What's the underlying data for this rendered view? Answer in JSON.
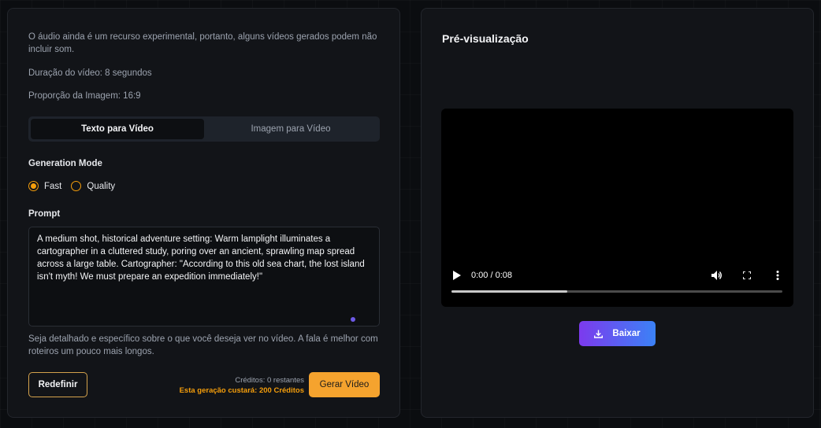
{
  "generator": {
    "notes": {
      "audio": "O áudio ainda é um recurso experimental, portanto, alguns vídeos gerados podem não incluir som.",
      "duration": "Duração do vídeo: 8 segundos",
      "aspect": "Proporção da Imagem: 16:9"
    },
    "tabs": [
      {
        "label": "Texto para Vídeo",
        "active": true
      },
      {
        "label": "Imagem para Vídeo",
        "active": false
      }
    ],
    "generation_mode": {
      "label": "Generation Mode",
      "options": [
        "Fast",
        "Quality"
      ],
      "selected": "Fast"
    },
    "prompt": {
      "label": "Prompt",
      "value": "A medium shot, historical adventure setting: Warm lamplight illuminates a cartographer in a cluttered study, poring over an ancient, sprawling map spread across a large table. Cartographer: \"According to this old sea chart, the lost island isn't myth! We must prepare an expedition immediately!\""
    },
    "hint": "Seja detalhado e específico sobre o que você deseja ver no vídeo. A fala é melhor com roteiros um pouco mais longos.",
    "reset_label": "Redefinir",
    "credits_remaining": "Créditos: 0 restantes",
    "cost_note": "Esta geração custará: 200 Créditos",
    "generate_label": "Gerar Vídeo"
  },
  "preview": {
    "title": "Pré-visualização",
    "video": {
      "time": "0:00 / 0:08",
      "progress": 0.35
    },
    "download_label": "Baixar"
  },
  "colors": {
    "accent": "#f5a32e",
    "download_gradient_start": "#7c3aed",
    "download_gradient_end": "#3b82f6"
  }
}
